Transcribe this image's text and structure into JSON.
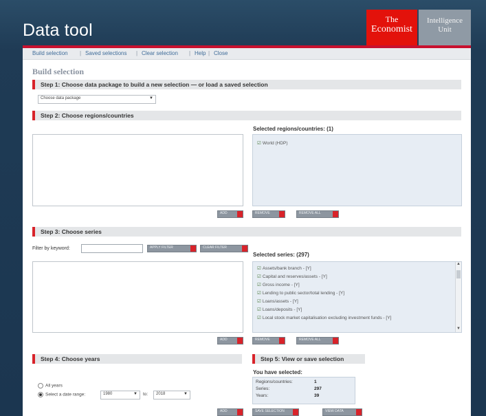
{
  "app": {
    "title": "Data tool",
    "logo_economist": [
      "The",
      "Economist"
    ],
    "logo_eiu": [
      "Intelligence",
      "Unit"
    ]
  },
  "nav": {
    "items": [
      "Build selection",
      "Saved selections",
      "Clear selection",
      "Help",
      "Close"
    ],
    "separator": "|"
  },
  "page": {
    "heading": "Build selection"
  },
  "step1": {
    "label": "Step 1: Choose data package to build a new selection — or load a saved selection",
    "select_value": "Choose data package",
    "arrow": "▼"
  },
  "step2": {
    "label": "Step 2: Choose regions/countries",
    "selected_label": "Selected regions/countries: (1)",
    "selected_items": [
      "World (HDP)"
    ],
    "buttons": {
      "add": "ADD",
      "remove": "REMOVE",
      "remove_all": "REMOVE ALL"
    }
  },
  "step3": {
    "label": "Step 3: Choose series",
    "filter_label": "Filter by keyword:",
    "filter_value": "",
    "apply_filter": "APPLY FILTER",
    "clear_filter": "CLEAR FILTER",
    "selected_label": "Selected series: (297)",
    "selected_items": [
      "Assets/bank branch - [Y]",
      "Capital and reserves/assets - [Y]",
      "Gross income - [Y]",
      "Lending to public sector/total lending - [Y]",
      "Loans/assets - [Y]",
      "Loans/deposits - [Y]",
      "Local stock market capitalisation excluding investment funds - [Y]"
    ],
    "buttons": {
      "add": "ADD",
      "remove": "REMOVE",
      "remove_all": "REMOVE ALL"
    }
  },
  "step4": {
    "label": "Step 4: Choose years",
    "option_all": "All years",
    "option_range": "Select a date range:",
    "from_value": "1980",
    "to_label": "to:",
    "to_value": "2018",
    "add_button": "ADD"
  },
  "step5": {
    "label": "Step 5: View or save selection",
    "you_have_selected": "You have selected:",
    "rows": [
      {
        "label": "Regions/countries:",
        "value": "1"
      },
      {
        "label": "Series:",
        "value": "297"
      },
      {
        "label": "Years:",
        "value": "39"
      }
    ],
    "save_button": "SAVE SELECTION",
    "view_button": "VIEW DATA"
  },
  "colors": {
    "accent": "#d8232a",
    "navy": "#1f3b55",
    "link": "#3f6c99"
  }
}
